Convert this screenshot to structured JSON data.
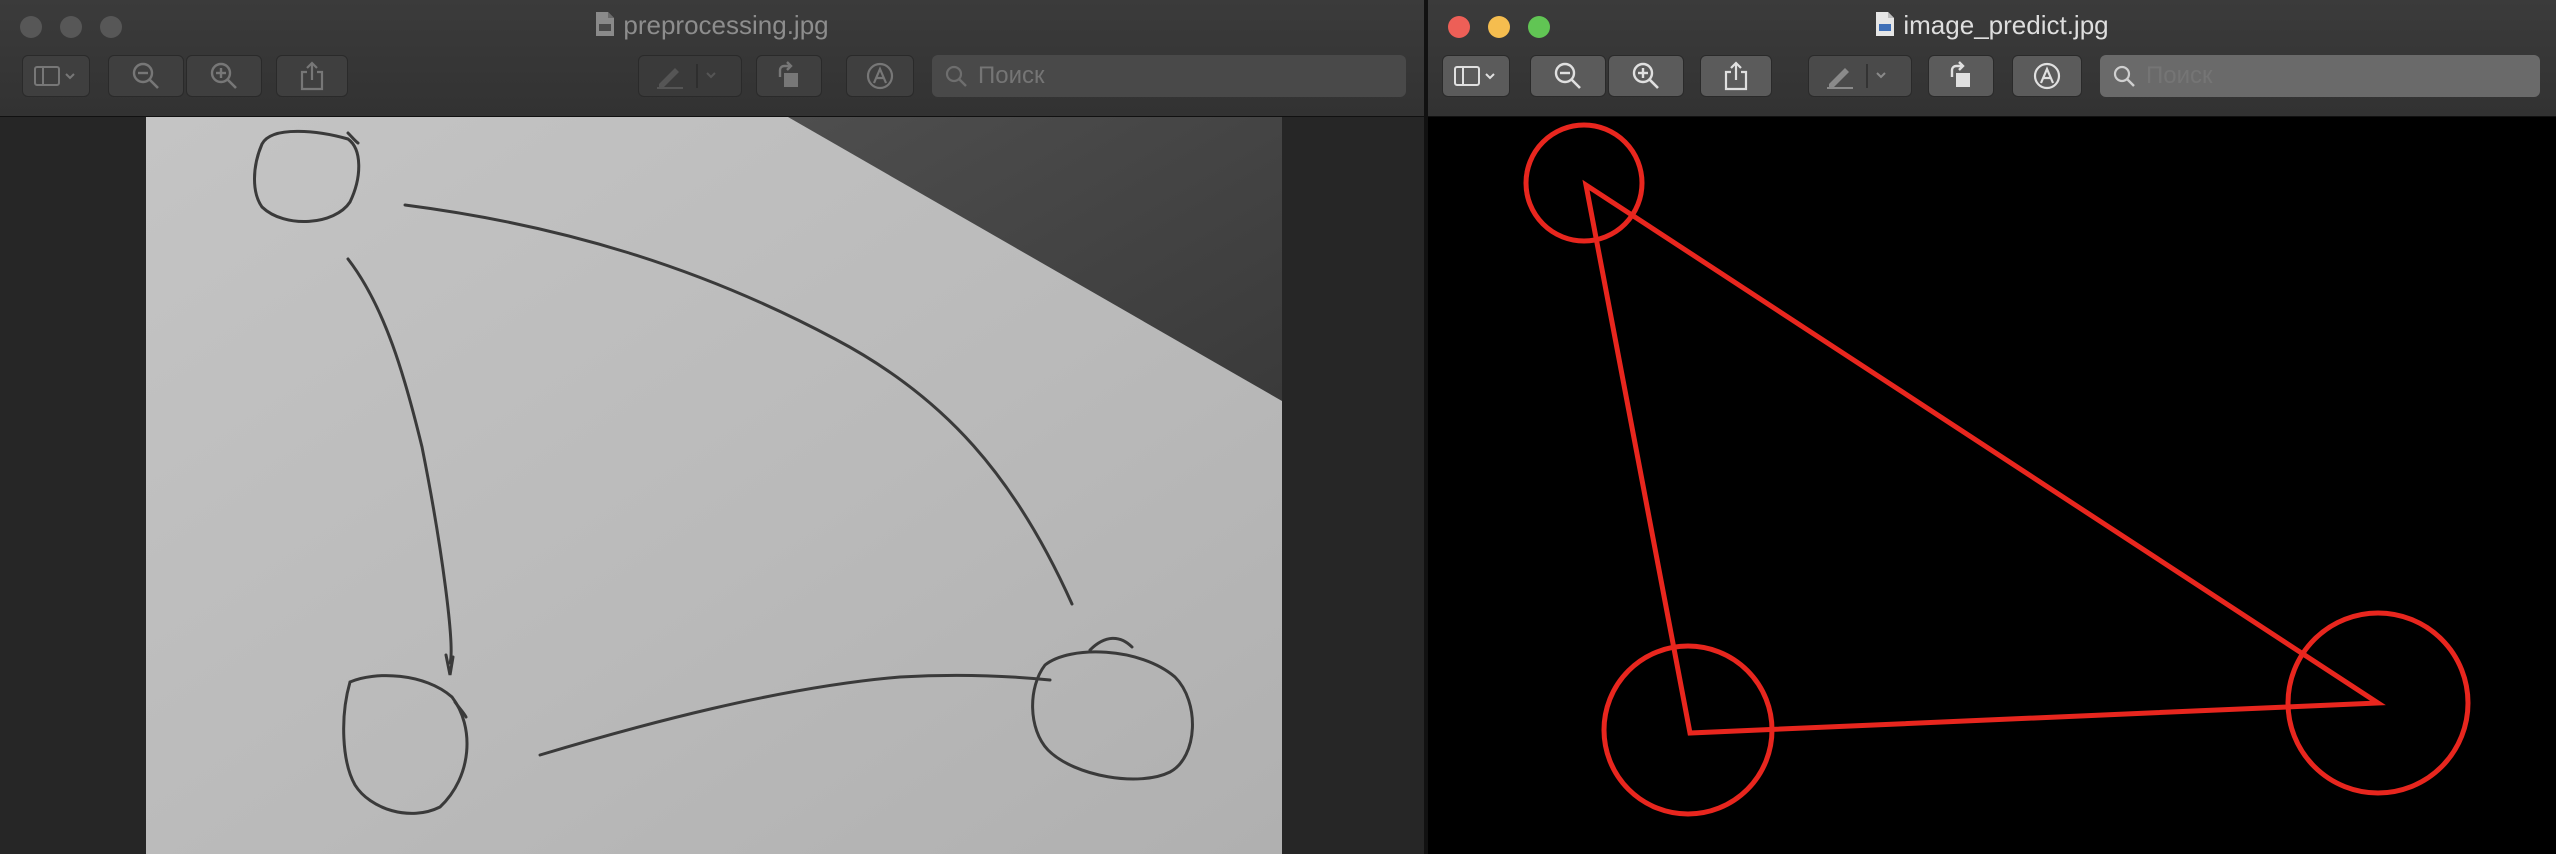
{
  "windows": {
    "left": {
      "title": "preprocessing.jpg",
      "search_placeholder": "Поиск",
      "active": false
    },
    "right": {
      "title": "image_predict.jpg",
      "search_placeholder": "Поиск",
      "active": true
    }
  },
  "icons": {
    "title": "jpeg-document-icon",
    "sidebar": "sidebar-icon",
    "zoom_out": "zoom-out-icon",
    "zoom_in": "zoom-in-icon",
    "share": "share-icon",
    "markup": "pen-icon",
    "rotate": "rotate-icon",
    "annotate": "markup-circle-icon",
    "search": "search-icon"
  },
  "colors": {
    "close": "#ed5f57",
    "minimize": "#f5bd4f",
    "zoom": "#61c554",
    "inactive_light": "#575757",
    "prediction_red": "#e8261e",
    "canvas_black": "#000000"
  }
}
